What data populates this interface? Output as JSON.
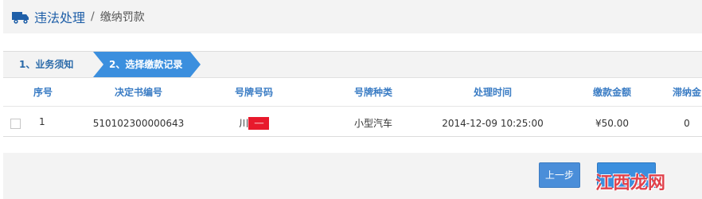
{
  "header": {
    "icon": "truck-icon",
    "title": "违法处理",
    "separator": "/",
    "subtitle": "缴纳罚款"
  },
  "steps": [
    {
      "label": "1、业务须知",
      "active": false
    },
    {
      "label": "2、选择缴款记录",
      "active": true
    }
  ],
  "table": {
    "columns": [
      "序号",
      "决定书编号",
      "号牌号码",
      "号牌种类",
      "处理时间",
      "缴款金额",
      "滞纳金"
    ],
    "rows": [
      {
        "index": "1",
        "decision_no": "510102300000643",
        "plate_prefix": "川",
        "plate_masked": "-----",
        "plate_type": "小型汽车",
        "time": "2014-12-09 10:25:00",
        "amount": "¥50.00",
        "late_fee": "0"
      }
    ]
  },
  "footer": {
    "prev_label": "上一步",
    "next_label": ""
  },
  "watermark": {
    "text": "江西龙网"
  },
  "colors": {
    "accent": "#3b8fde",
    "header_bg": "#f3f3f3",
    "link": "#1f5fa8",
    "mask_red": "#e8192c"
  }
}
